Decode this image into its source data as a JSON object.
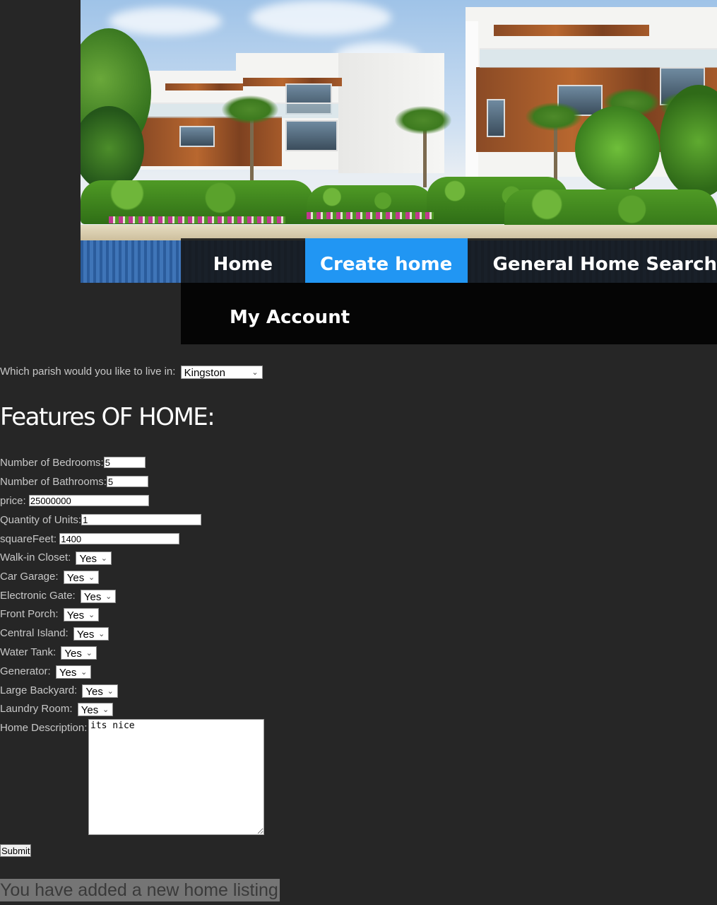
{
  "nav": {
    "home": "Home",
    "create_home": "Create home",
    "general_search": "General Home Search",
    "my_account": "My Account",
    "active_color": "#2196f3"
  },
  "hero": {
    "image": "luxury-townhouses-with-palms-and-pool"
  },
  "parish": {
    "label": "Which parish would you like to live in:",
    "selected": "Kingston"
  },
  "features_heading": "Features OF HOME:",
  "fields": {
    "bedrooms": {
      "label": "Number of Bedrooms:",
      "value": "5"
    },
    "bathrooms": {
      "label": "Number of Bathrooms:",
      "value": "5"
    },
    "price": {
      "label": "price:",
      "value": "25000000"
    },
    "units": {
      "label": "Quantity of Units:",
      "value": "1"
    },
    "sqft": {
      "label": "squareFeet:",
      "value": "1400"
    }
  },
  "options": {
    "walkin_closet": {
      "label": "Walk-in Closet:",
      "selected": "Yes"
    },
    "car_garage": {
      "label": "Car Garage:",
      "selected": "Yes"
    },
    "electronic_gate": {
      "label": "Electronic Gate:",
      "selected": "Yes"
    },
    "front_porch": {
      "label": "Front Porch:",
      "selected": "Yes"
    },
    "central_island": {
      "label": "Central Island:",
      "selected": "Yes"
    },
    "water_tank": {
      "label": "Water Tank:",
      "selected": "Yes"
    },
    "generator": {
      "label": "Generator:",
      "selected": "Yes"
    },
    "large_backyard": {
      "label": "Large Backyard:",
      "selected": "Yes"
    },
    "laundry_room": {
      "label": "Laundry Room:",
      "selected": "Yes"
    }
  },
  "description": {
    "label": "Home Description:",
    "value": "its nice"
  },
  "submit_label": "Submit",
  "success_message": "You have added a new home listing"
}
